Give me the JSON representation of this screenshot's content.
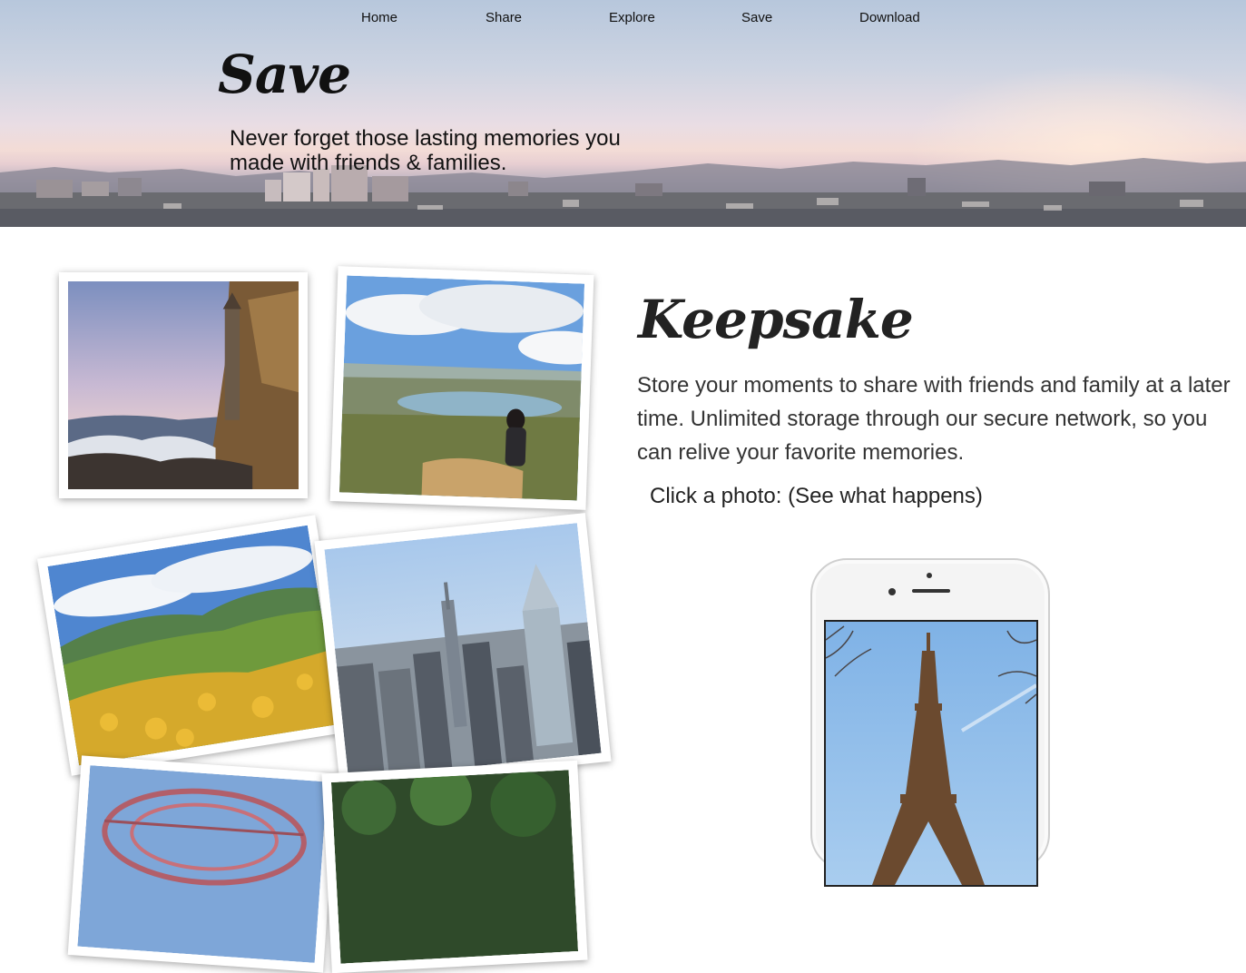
{
  "nav": {
    "items": [
      {
        "label": "Home"
      },
      {
        "label": "Share"
      },
      {
        "label": "Explore"
      },
      {
        "label": "Save"
      },
      {
        "label": "Download"
      }
    ]
  },
  "hero": {
    "title": "Save",
    "subtitle": "Never forget those lasting memories you made with friends & families."
  },
  "keepsake": {
    "title": "Keepsake",
    "description": "Store your moments to share with friends and family at a later time. Unlimited storage through our secure network, so you can relive your favorite memories.",
    "hint": "Click a photo: (See what happens)"
  },
  "photos": [
    {
      "name": "sea-tower-photo"
    },
    {
      "name": "lake-overlook-photo"
    },
    {
      "name": "poppy-hills-photo"
    },
    {
      "name": "city-skyline-photo"
    },
    {
      "name": "dome-structure-photo"
    },
    {
      "name": "forest-photo"
    }
  ],
  "phone": {
    "screen_image": "eiffel-tower"
  }
}
